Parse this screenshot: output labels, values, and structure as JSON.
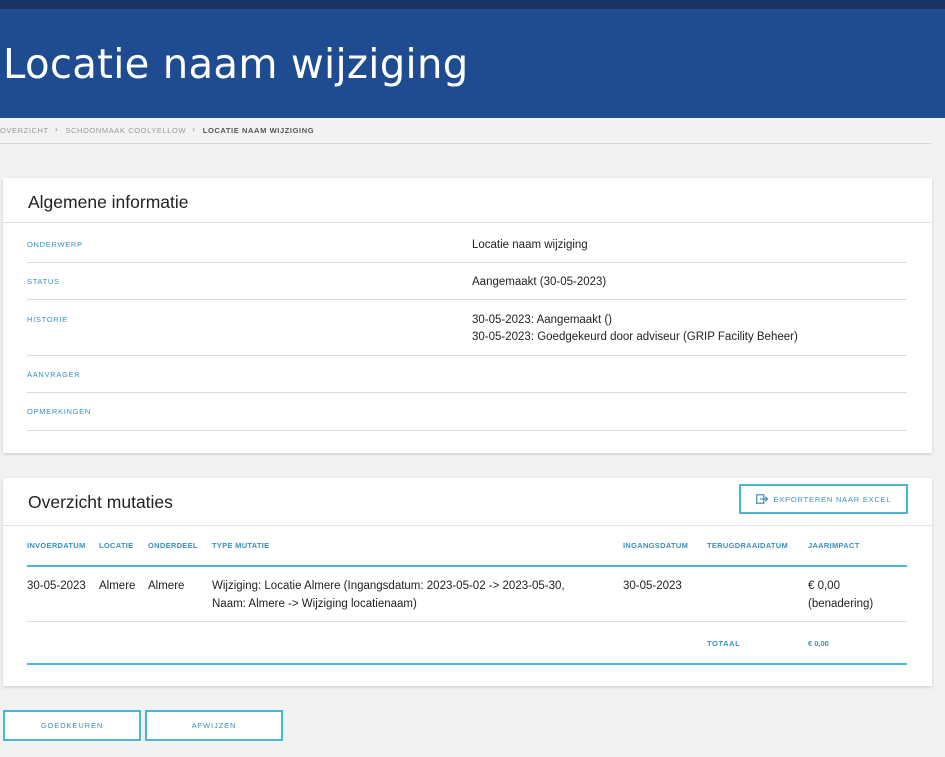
{
  "page": {
    "title": "Locatie naam wijziging"
  },
  "breadcrumb": {
    "items": [
      "OVERZICHT",
      "SCHOONMAAK COOLYELLOW",
      "LOCATIE NAAM WIJZIGING"
    ]
  },
  "general": {
    "title": "Algemene informatie",
    "rows": [
      {
        "label": "ONDERWERP",
        "value": "Locatie naam wijziging"
      },
      {
        "label": "STATUS",
        "value": "Aangemaakt (30-05-2023)"
      },
      {
        "label": "HISTORIE",
        "value_lines": [
          "30-05-2023: Aangemaakt ()",
          "30-05-2023: Goedgekeurd door adviseur (GRIP Facility Beheer)"
        ]
      },
      {
        "label": "AANVRAGER",
        "value": ""
      },
      {
        "label": "OPMERKINGEN",
        "value": ""
      }
    ]
  },
  "mutations": {
    "title": "Overzicht mutaties",
    "export_label": "EXPORTEREN NAAR EXCEL",
    "export_icon": "export-icon",
    "columns": [
      "INVOERDATUM",
      "LOCATIE",
      "ONDERDEEL",
      "TYPE MUTATIE",
      "INGANGSDATUM",
      "TERUGDRAAIDATUM",
      "JAARIMPACT"
    ],
    "rows": [
      {
        "invoerdatum": "30-05-2023",
        "locatie": "Almere",
        "onderdeel": "Almere",
        "type_mutatie_lines": [
          "Wijziging: Locatie Almere (Ingangsdatum: 2023-05-02 -> 2023-05-30,",
          "Naam: Almere -> Wijziging locatienaam)"
        ],
        "ingangsdatum": "30-05-2023",
        "terugdraaidatum": "",
        "jaarimpact_lines": [
          "€ 0,00",
          "(benadering)"
        ]
      }
    ],
    "total_label": "TOTAAL",
    "total_value": "€ 0,00"
  },
  "actions": {
    "approve_label": "GOEDKEUREN",
    "reject_label": "AFWIJZEN"
  },
  "colors": {
    "header_bg": "#1f4c91",
    "topbar_bg": "#1d3463",
    "accent": "#4ab6cf",
    "label": "#3a8fbd"
  }
}
